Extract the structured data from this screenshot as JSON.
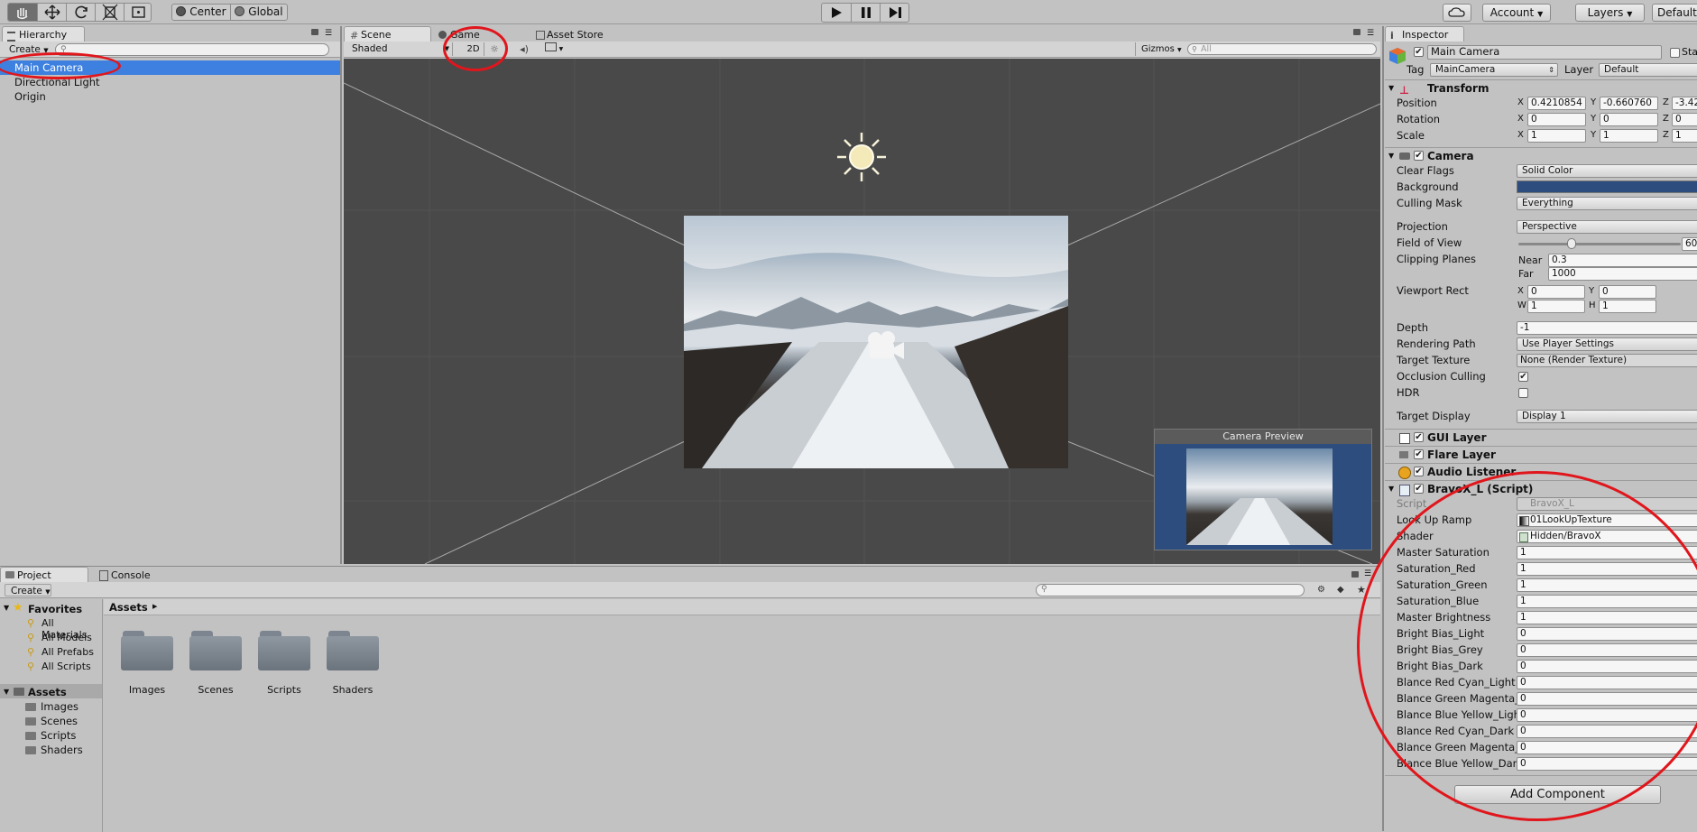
{
  "toolbar": {
    "pivot_label": "Center",
    "space_label": "Global",
    "account_label": "Account",
    "layers_label": "Layers",
    "layout_label": "Default"
  },
  "hierarchy": {
    "tab": "Hierarchy",
    "create_label": "Create",
    "items": [
      "Main Camera",
      "Directional Light",
      "Origin"
    ]
  },
  "scene": {
    "tabs": [
      "Scene",
      "Game",
      "Asset Store"
    ],
    "shading_mode": "Shaded",
    "mode_2d": "2D",
    "gizmos_label": "Gizmos",
    "search_placeholder": "All",
    "camera_preview_title": "Camera Preview"
  },
  "project": {
    "tabs": [
      "Project",
      "Console"
    ],
    "create_label": "Create",
    "favorites_label": "Favorites",
    "favorites": [
      "All Materials",
      "All Models",
      "All Prefabs",
      "All Scripts"
    ],
    "assets_label": "Assets",
    "asset_folders": [
      "Images",
      "Scenes",
      "Scripts",
      "Shaders"
    ],
    "breadcrumb": "Assets",
    "folders": [
      "Images",
      "Scenes",
      "Scripts",
      "Shaders"
    ]
  },
  "inspector": {
    "tab": "Inspector",
    "object_name": "Main Camera",
    "static_label": "Sta",
    "tag_label": "Tag",
    "tag_value": "MainCamera",
    "layer_label": "Layer",
    "layer_value": "Default",
    "transform": {
      "title": "Transform",
      "position_label": "Position",
      "position": [
        "0.4210854",
        "-0.660760",
        "-3.42"
      ],
      "rotation_label": "Rotation",
      "rotation": [
        "0",
        "0",
        "0"
      ],
      "scale_label": "Scale",
      "scale": [
        "1",
        "1",
        "1"
      ]
    },
    "camera": {
      "title": "Camera",
      "clear_flags_label": "Clear Flags",
      "clear_flags": "Solid Color",
      "background_label": "Background",
      "background_color": "#2c4d7e",
      "culling_mask_label": "Culling Mask",
      "culling_mask": "Everything",
      "projection_label": "Projection",
      "projection": "Perspective",
      "fov_label": "Field of View",
      "fov": "60",
      "fov_fraction": 0.33,
      "clipping_label": "Clipping Planes",
      "near_label": "Near",
      "near": "0.3",
      "far_label": "Far",
      "far": "1000",
      "viewport_label": "Viewport Rect",
      "vp_x": "0",
      "vp_y": "0",
      "vp_w": "1",
      "vp_h": "1",
      "depth_label": "Depth",
      "depth": "-1",
      "rendering_path_label": "Rendering Path",
      "rendering_path": "Use Player Settings",
      "target_texture_label": "Target Texture",
      "target_texture": "None (Render Texture)",
      "occlusion_label": "Occlusion Culling",
      "hdr_label": "HDR",
      "target_display_label": "Target Display",
      "target_display": "Display 1"
    },
    "components": [
      "GUI Layer",
      "Flare Layer",
      "Audio Listener"
    ],
    "script": {
      "title": "BravoX_L (Script)",
      "script_label": "Script",
      "script_value": "BravoX_L",
      "lookup_label": "Look Up Ramp",
      "lookup_value": "01LookUpTexture",
      "shader_label": "Shader",
      "shader_value": "Hidden/BravoX",
      "params": [
        {
          "label": "Master Saturation",
          "value": "1"
        },
        {
          "label": "Saturation_Red",
          "value": "1"
        },
        {
          "label": "Saturation_Green",
          "value": "1"
        },
        {
          "label": "Saturation_Blue",
          "value": "1"
        },
        {
          "label": "Master Brightness",
          "value": "1"
        },
        {
          "label": "Bright Bias_Light",
          "value": "0"
        },
        {
          "label": "Bright Bias_Grey",
          "value": "0"
        },
        {
          "label": "Bright Bias_Dark",
          "value": "0"
        },
        {
          "label": "Blance Red Cyan_Light",
          "value": "0"
        },
        {
          "label": "Blance Green Magenta_",
          "value": "0"
        },
        {
          "label": "Blance Blue Yellow_Ligh",
          "value": "0"
        },
        {
          "label": "Blance Red Cyan_Dark",
          "value": "0"
        },
        {
          "label": "Blance Green Magenta_",
          "value": "0"
        },
        {
          "label": "Blance Blue Yellow_Dar",
          "value": "0"
        }
      ]
    },
    "add_component_label": "Add Component"
  },
  "colors": {
    "selection": "#3d80df",
    "scene_bg": "#494949",
    "annotation_red": "#e0161c"
  }
}
